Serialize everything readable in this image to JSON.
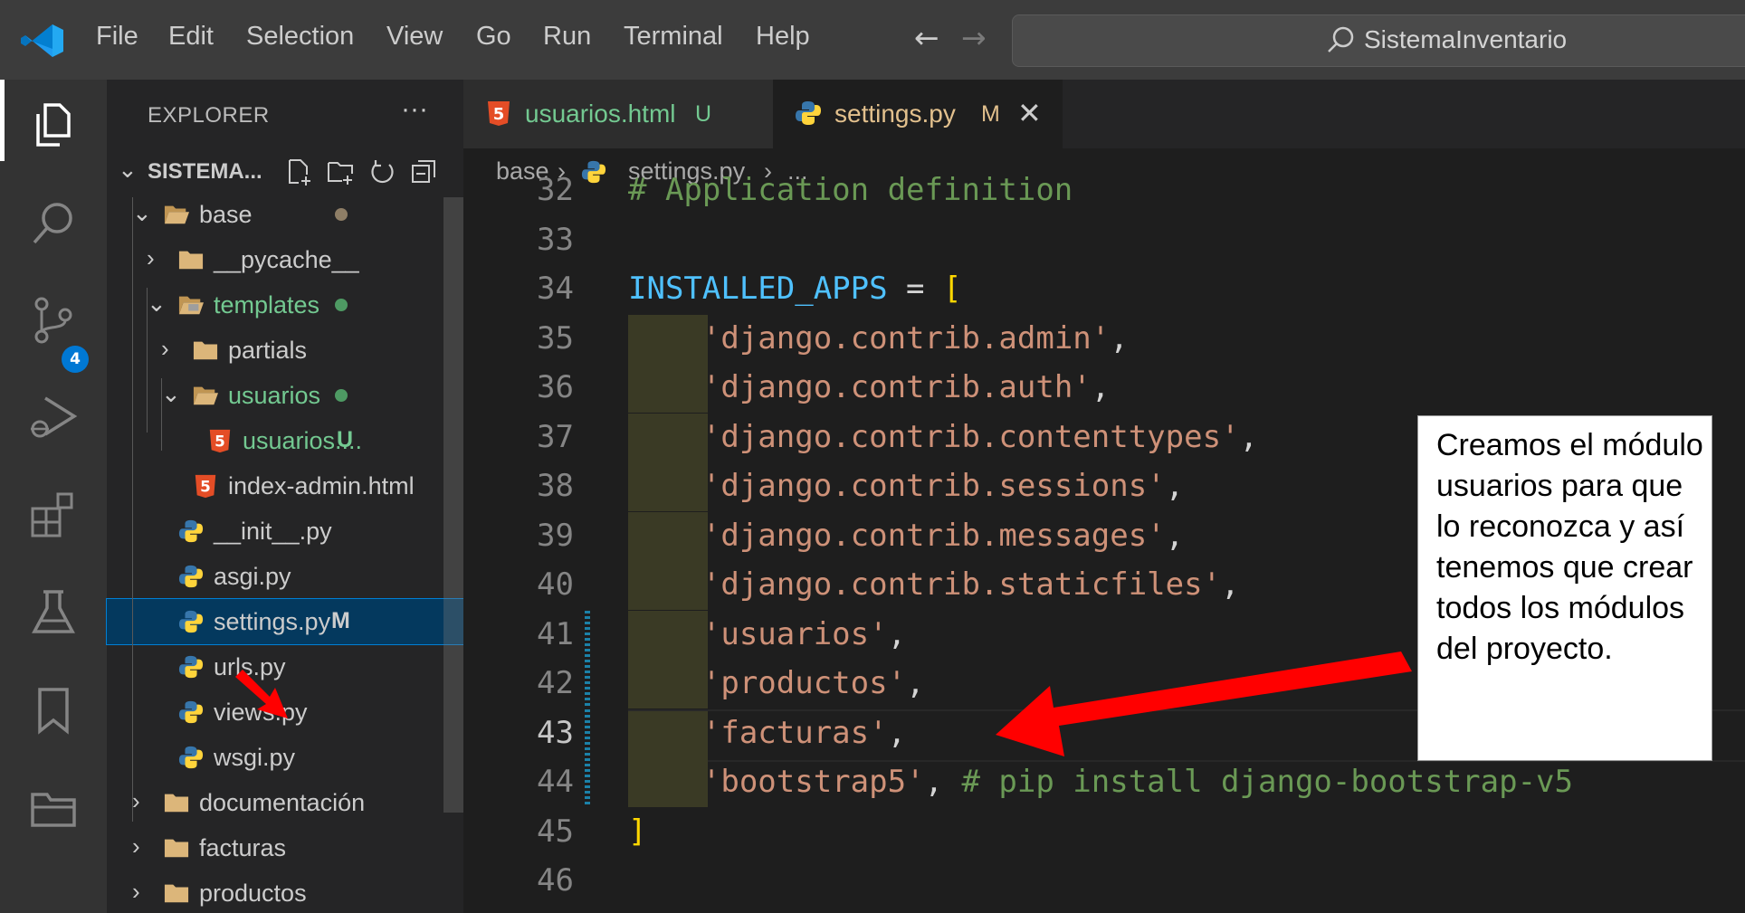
{
  "titlebar": {
    "menu": [
      "File",
      "Edit",
      "Selection",
      "View",
      "Go",
      "Run",
      "Terminal",
      "Help"
    ],
    "back_arrow": "←",
    "forward_arrow": "→",
    "search_text": "SistemaInventario"
  },
  "activitybar": {
    "icons": [
      "explorer-icon",
      "search-icon",
      "source-control-icon",
      "run-debug-icon",
      "extensions-icon",
      "testing-icon",
      "bookmarks-icon",
      "project-manager-icon"
    ],
    "scm_badge": "4"
  },
  "sidebar": {
    "title": "EXPLORER",
    "more": "···",
    "workspace": "SISTEMA...",
    "tree": [
      {
        "label": "base",
        "kind": "folder",
        "expanded": true,
        "status_dot": true
      },
      {
        "label": "__pycache__",
        "kind": "folder",
        "expanded": false
      },
      {
        "label": "templates",
        "kind": "folder",
        "expanded": true,
        "status_dot": true
      },
      {
        "label": "partials",
        "kind": "folder",
        "expanded": false
      },
      {
        "label": "usuarios",
        "kind": "folder",
        "expanded": true,
        "status_dot": true
      },
      {
        "label": "usuarios....",
        "kind": "html",
        "status": "U"
      },
      {
        "label": "index-admin.html",
        "kind": "html"
      },
      {
        "label": "__init__.py",
        "kind": "python"
      },
      {
        "label": "asgi.py",
        "kind": "python"
      },
      {
        "label": "settings.py",
        "kind": "python",
        "status": "M",
        "selected": true
      },
      {
        "label": "urls.py",
        "kind": "python"
      },
      {
        "label": "views.py",
        "kind": "python"
      },
      {
        "label": "wsgi.py",
        "kind": "python"
      },
      {
        "label": "documentación",
        "kind": "folder",
        "expanded": false
      },
      {
        "label": "facturas",
        "kind": "folder",
        "expanded": false
      },
      {
        "label": "productos",
        "kind": "folder",
        "expanded": false
      }
    ]
  },
  "tabs": [
    {
      "label": "usuarios.html",
      "status": "U",
      "active": false
    },
    {
      "label": "settings.py",
      "status": "M",
      "active": true,
      "close": "✕"
    }
  ],
  "breadcrumb": {
    "folder": "base",
    "sep1": "›",
    "file": "settings.py",
    "sep2": "›",
    "more": "..."
  },
  "code": {
    "lines": [
      {
        "num": "32",
        "parts": [
          {
            "t": "# Application definition",
            "c": "comment"
          }
        ]
      },
      {
        "num": "33",
        "parts": []
      },
      {
        "num": "34",
        "parts": [
          {
            "t": "INSTALLED_APPS",
            "c": "var"
          },
          {
            "t": " = ",
            "c": "op"
          },
          {
            "t": "[",
            "c": "brk"
          }
        ]
      },
      {
        "num": "35",
        "parts": [
          {
            "t": "    ",
            "c": "op"
          },
          {
            "t": "'django.contrib.admin'",
            "c": "str"
          },
          {
            "t": ",",
            "c": "punc"
          }
        ]
      },
      {
        "num": "36",
        "parts": [
          {
            "t": "    ",
            "c": "op"
          },
          {
            "t": "'django.contrib.auth'",
            "c": "str"
          },
          {
            "t": ",",
            "c": "punc"
          }
        ]
      },
      {
        "num": "37",
        "parts": [
          {
            "t": "    ",
            "c": "op"
          },
          {
            "t": "'django.contrib.contenttypes'",
            "c": "str"
          },
          {
            "t": ",",
            "c": "punc"
          }
        ]
      },
      {
        "num": "38",
        "parts": [
          {
            "t": "    ",
            "c": "op"
          },
          {
            "t": "'django.contrib.sessions'",
            "c": "str"
          },
          {
            "t": ",",
            "c": "punc"
          }
        ]
      },
      {
        "num": "39",
        "parts": [
          {
            "t": "    ",
            "c": "op"
          },
          {
            "t": "'django.contrib.messages'",
            "c": "str"
          },
          {
            "t": ",",
            "c": "punc"
          }
        ]
      },
      {
        "num": "40",
        "parts": [
          {
            "t": "    ",
            "c": "op"
          },
          {
            "t": "'django.contrib.staticfiles'",
            "c": "str"
          },
          {
            "t": ",",
            "c": "punc"
          }
        ]
      },
      {
        "num": "41",
        "parts": [
          {
            "t": "    ",
            "c": "op"
          },
          {
            "t": "'usuarios'",
            "c": "str"
          },
          {
            "t": ",",
            "c": "punc"
          }
        ]
      },
      {
        "num": "42",
        "parts": [
          {
            "t": "    ",
            "c": "op"
          },
          {
            "t": "'productos'",
            "c": "str"
          },
          {
            "t": ",",
            "c": "punc"
          }
        ]
      },
      {
        "num": "43",
        "parts": [
          {
            "t": "    ",
            "c": "op"
          },
          {
            "t": "'facturas'",
            "c": "str"
          },
          {
            "t": ",",
            "c": "punc"
          }
        ]
      },
      {
        "num": "44",
        "parts": [
          {
            "t": "    ",
            "c": "op"
          },
          {
            "t": "'bootstrap5'",
            "c": "str"
          },
          {
            "t": ", ",
            "c": "punc"
          },
          {
            "t": "# pip install django-bootstrap-v5",
            "c": "comment"
          }
        ]
      },
      {
        "num": "45",
        "parts": [
          {
            "t": "]",
            "c": "brk"
          }
        ]
      },
      {
        "num": "46",
        "parts": []
      }
    ],
    "current_line": "43"
  },
  "annotation": {
    "text": "Creamos el módulo usuarios para que lo reconozca y así tenemos que crear todos los módulos del proyecto."
  },
  "colors": {
    "accent": "#0078d4",
    "string": "#ce9178",
    "comment": "#6a9955",
    "variable": "#4fc1ff",
    "untracked": "#73c991",
    "modified": "#e2c08d",
    "annotation_arrow": "#ff0000"
  }
}
